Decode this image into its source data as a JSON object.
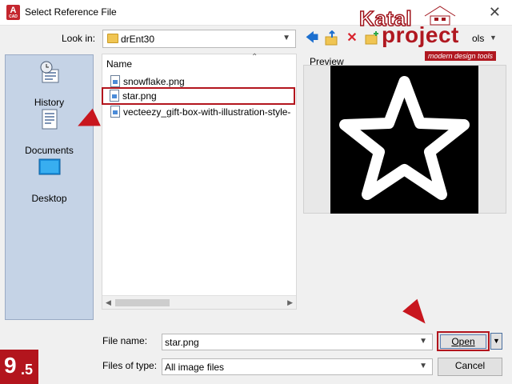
{
  "window": {
    "title": "Select Reference File",
    "app_icon": "A",
    "app_icon_sub": "CAD"
  },
  "watermark": {
    "line1": "Katal",
    "line2": "project",
    "tagline": "modern design tools"
  },
  "toolbar": {
    "lookin_label": "Look in:",
    "lookin_value": "drEnt30",
    "tools_label": "ols",
    "icons": [
      "back-arrow-icon",
      "up-folder-icon",
      "delete-icon",
      "new-folder-icon"
    ]
  },
  "places": [
    {
      "label": "History",
      "icon": "history-icon"
    },
    {
      "label": "Documents",
      "icon": "documents-icon"
    },
    {
      "label": "Desktop",
      "icon": "desktop-icon"
    }
  ],
  "filelist": {
    "column_header": "Name",
    "files": [
      {
        "name": "snowflake.png",
        "selected": false
      },
      {
        "name": "star.png",
        "selected": true
      },
      {
        "name": "vecteezy_gift-box-with-illustration-style-",
        "selected": false
      }
    ]
  },
  "preview": {
    "label": "Preview"
  },
  "form": {
    "file_name_label": "File name:",
    "file_name_value": "star.png",
    "file_type_label": "Files of type:",
    "file_type_value": "All image files"
  },
  "buttons": {
    "open": "Open",
    "cancel": "Cancel"
  },
  "step_badge": {
    "major": "9",
    "minor": ".5"
  },
  "colors": {
    "highlight": "#b3151d",
    "places_bg": "#c5d3e6"
  }
}
